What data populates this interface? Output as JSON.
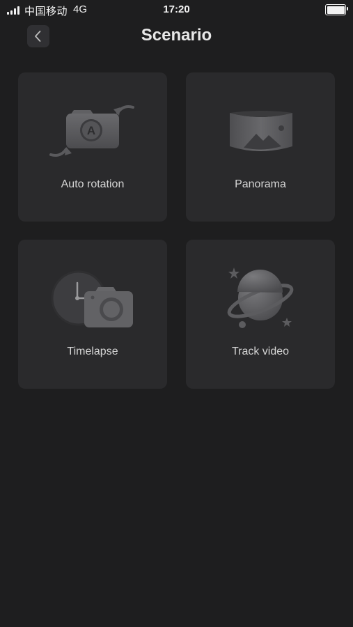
{
  "status_bar": {
    "carrier": "中国移动",
    "network": "4G",
    "time": "17:20",
    "battery_level": 1.0
  },
  "header": {
    "title": "Scenario",
    "back_icon": "chevron-left-icon"
  },
  "scenarios": [
    {
      "label": "Auto rotation",
      "icon": "auto-rotation-camera-icon"
    },
    {
      "label": "Panorama",
      "icon": "panorama-icon"
    },
    {
      "label": "Timelapse",
      "icon": "timelapse-clock-camera-icon"
    },
    {
      "label": "Track video",
      "icon": "planet-track-icon"
    }
  ],
  "colors": {
    "background": "#1e1e1f",
    "card": "#2a2a2c",
    "icon_gray": "#5f5f62"
  }
}
